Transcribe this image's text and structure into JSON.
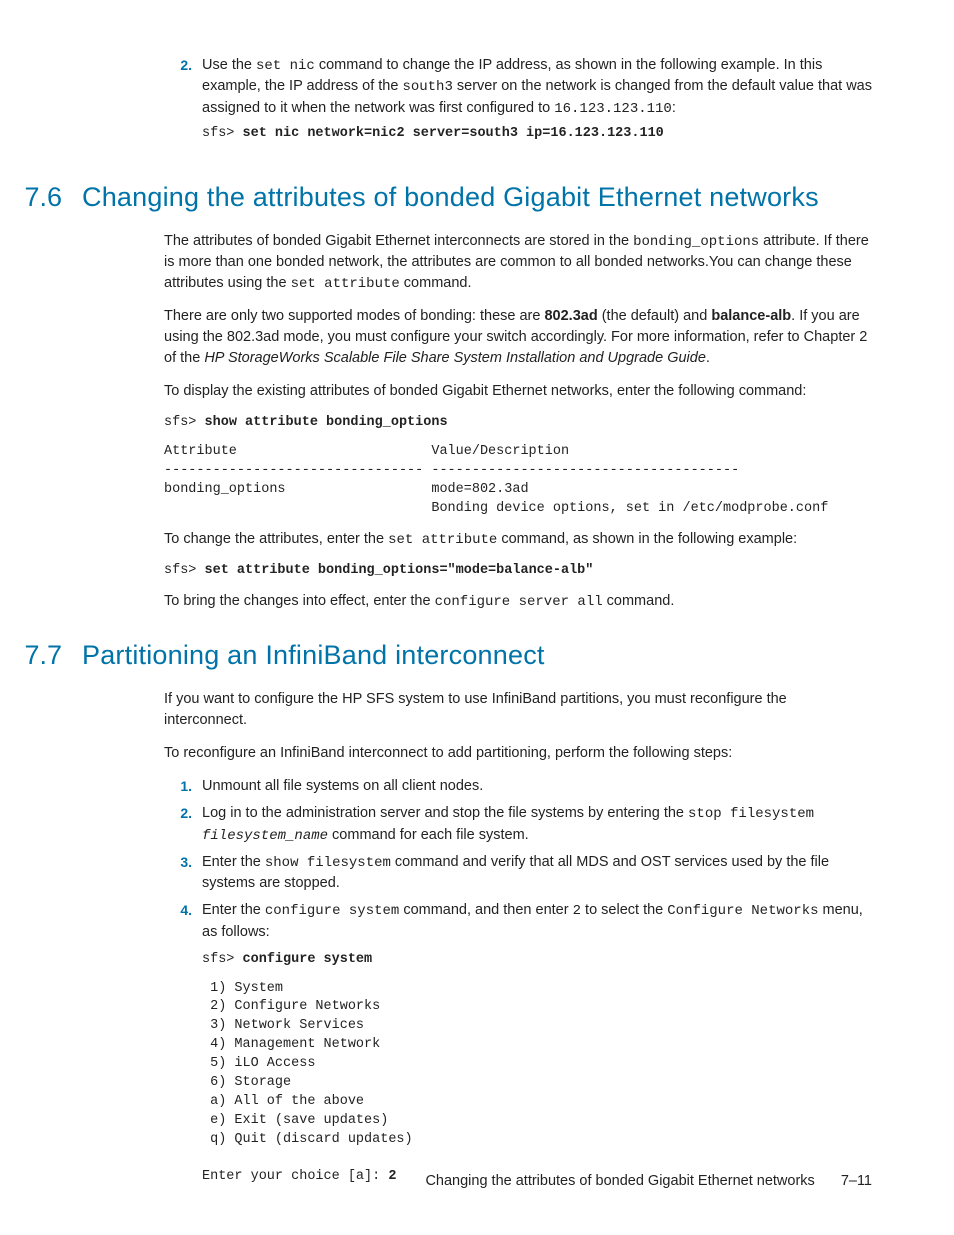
{
  "top_item": {
    "num": "2.",
    "text_a": "Use the ",
    "code_a": "set nic",
    "text_b": " command to change the IP address, as shown in the following example. In this example, the IP address of the ",
    "code_b": "south3",
    "text_c": " server on the network is changed from the default value that was assigned to it when the network was first configured to ",
    "code_c": "16.123.123.110",
    "text_d": ":",
    "cmd_prompt": "sfs> ",
    "cmd_bold": "set nic network=nic2 server=south3 ip=16.123.123.110"
  },
  "sec76": {
    "num": "7.6",
    "title": "Changing the attributes of bonded Gigabit Ethernet networks",
    "p1_a": "The attributes of bonded Gigabit Ethernet interconnects are stored in the ",
    "p1_code": "bonding_options",
    "p1_b": " attribute. If there is more than one bonded network, the attributes are common to all bonded networks.You can change these attributes using the ",
    "p1_code2": "set attribute",
    "p1_c": " command.",
    "p2_a": "There are only two supported modes of bonding: these are ",
    "p2_b1": "802.3ad",
    "p2_b": " (the default) and ",
    "p2_b2": "balance-alb",
    "p2_c": ". If you are using the 802.3ad mode, you must configure your switch accordingly. For more information, refer to Chapter 2 of the ",
    "p2_ital": "HP StorageWorks Scalable File Share System Installation and Upgrade Guide",
    "p2_d": ".",
    "p3": "To display the existing attributes of bonded Gigabit Ethernet networks, enter the following command:",
    "cmd1_prompt": "sfs> ",
    "cmd1_bold": "show attribute bonding_options",
    "table": "Attribute                        Value/Description\n-------------------------------- --------------------------------------\nbonding_options                  mode=802.3ad\n                                 Bonding device options, set in /etc/modprobe.conf",
    "p4_a": "To change the attributes, enter the ",
    "p4_code": "set attribute",
    "p4_b": " command, as shown in the following example:",
    "cmd2_prompt": "sfs> ",
    "cmd2_bold": "set attribute bonding_options=\"mode=balance-alb\"",
    "p5_a": "To bring the changes into effect, enter the ",
    "p5_code": "configure server all",
    "p5_b": " command."
  },
  "sec77": {
    "num": "7.7",
    "title": "Partitioning an InfiniBand interconnect",
    "p1": "If you want to configure the HP SFS system to use InfiniBand partitions, you must reconfigure the interconnect.",
    "p2": "To reconfigure an InfiniBand interconnect to add partitioning, perform the following steps:",
    "items": [
      {
        "num": "1.",
        "a": "Unmount all file systems on all client nodes."
      },
      {
        "num": "2.",
        "a": "Log in to the administration server and stop the file systems by entering the ",
        "code1": "stop filesystem",
        "ital": " filesystem_name",
        "b": " command for each file system."
      },
      {
        "num": "3.",
        "a": "Enter the ",
        "code1": "show filesystem",
        "b": " command and verify that all MDS and OST services used by the file systems are stopped."
      },
      {
        "num": "4.",
        "a": "Enter the ",
        "code1": "configure system",
        "b": " command, and then enter ",
        "code2": "2",
        "c": " to select the ",
        "code3": "Configure Networks",
        "d": " menu, as follows:"
      }
    ],
    "cmd_prompt": "sfs> ",
    "cmd_bold": "configure system",
    "menu": " 1) System\n 2) Configure Networks\n 3) Network Services\n 4) Management Network\n 5) iLO Access\n 6) Storage\n a) All of the above\n e) Exit (save updates)\n q) Quit (discard updates)\n\nEnter your choice [a]: ",
    "menu_bold": "2"
  },
  "footer": {
    "text": "Changing the attributes of bonded Gigabit Ethernet networks",
    "page": "7–11"
  }
}
